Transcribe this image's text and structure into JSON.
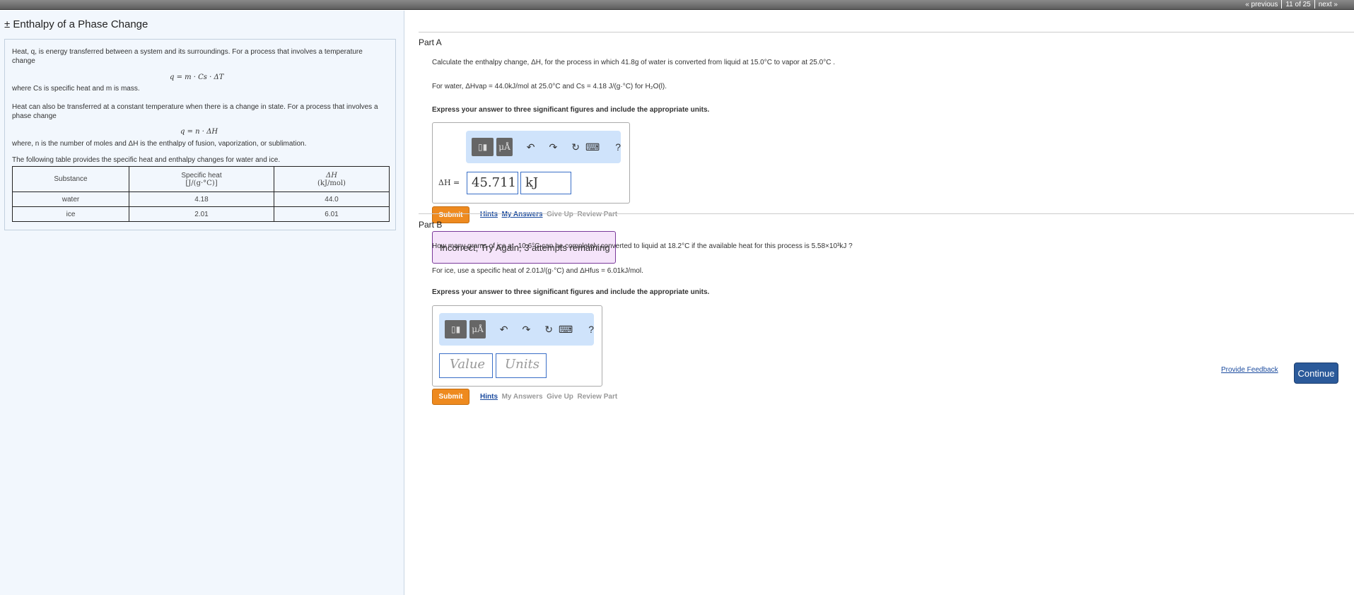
{
  "nav": {
    "previous": "« previous",
    "position": "11 of 25",
    "next": "next »"
  },
  "title": "± Enthalpy of a Phase Change",
  "intro": {
    "p1": "Heat, q, is energy transferred between a system and its surroundings. For a process that involves a temperature change",
    "formula1": "q = m · Cs · ΔT",
    "p2": "where Cs is specific heat and m is mass.",
    "p3": "Heat can also be transferred at a constant temperature when there is a change in state. For a process that involves a phase change",
    "formula2": "q = n · ΔH",
    "p4": "where, n is the number of moles and ΔH is the enthalpy of fusion, vaporization, or sublimation.",
    "caption": "The following table provides the specific heat and enthalpy changes for water and ice."
  },
  "table": {
    "headers": [
      "Substance",
      "Specific heat",
      "[J/(g·°C)]",
      "ΔH",
      "(kJ/mol)"
    ],
    "rows": [
      [
        "water",
        "4.18",
        "44.0"
      ],
      [
        "ice",
        "2.01",
        "6.01"
      ]
    ]
  },
  "partA": {
    "label": "Part A",
    "q1": "Calculate the enthalpy change, ΔH, for the process in which 41.8g of water is converted from liquid at 15.0°C to vapor at 25.0°C .",
    "q2": "For water, ΔHvap = 44.0kJ/mol at 25.0°C and Cs = 4.18 J/(g·°C) for H₂O(l).",
    "instr": "Express your answer to three significant figures and include the appropriate units.",
    "answer_label": "ΔH =",
    "value": "45.711",
    "units": "kJ",
    "submit": "Submit",
    "hints": "Hints",
    "my_answers": "My Answers",
    "give_up": "Give Up",
    "review": "Review Part",
    "feedback": "Incorrect; Try Again; 3 attempts remaining"
  },
  "partB": {
    "label": "Part B",
    "q1": "How many grams of ice at -10.6°C can be completely converted to liquid at 18.2°C if the available heat for this process is 5.58×10³kJ ?",
    "q2": "For ice, use a specific heat of 2.01J/(g·°C) and ΔHfus = 6.01kJ/mol.",
    "instr": "Express your answer to three significant figures and include the appropriate units.",
    "value_placeholder": "Value",
    "units_placeholder": "Units",
    "submit": "Submit",
    "hints": "Hints",
    "my_answers": "My Answers",
    "give_up": "Give Up",
    "review": "Review Part"
  },
  "toolbar": {
    "templates": "▯▮",
    "units": "μÅ",
    "undo": "↶",
    "redo": "↷",
    "reset": "↻",
    "keyboard": "⌨",
    "help": "?"
  },
  "footer": {
    "feedback": "Provide Feedback",
    "continue": "Continue"
  }
}
